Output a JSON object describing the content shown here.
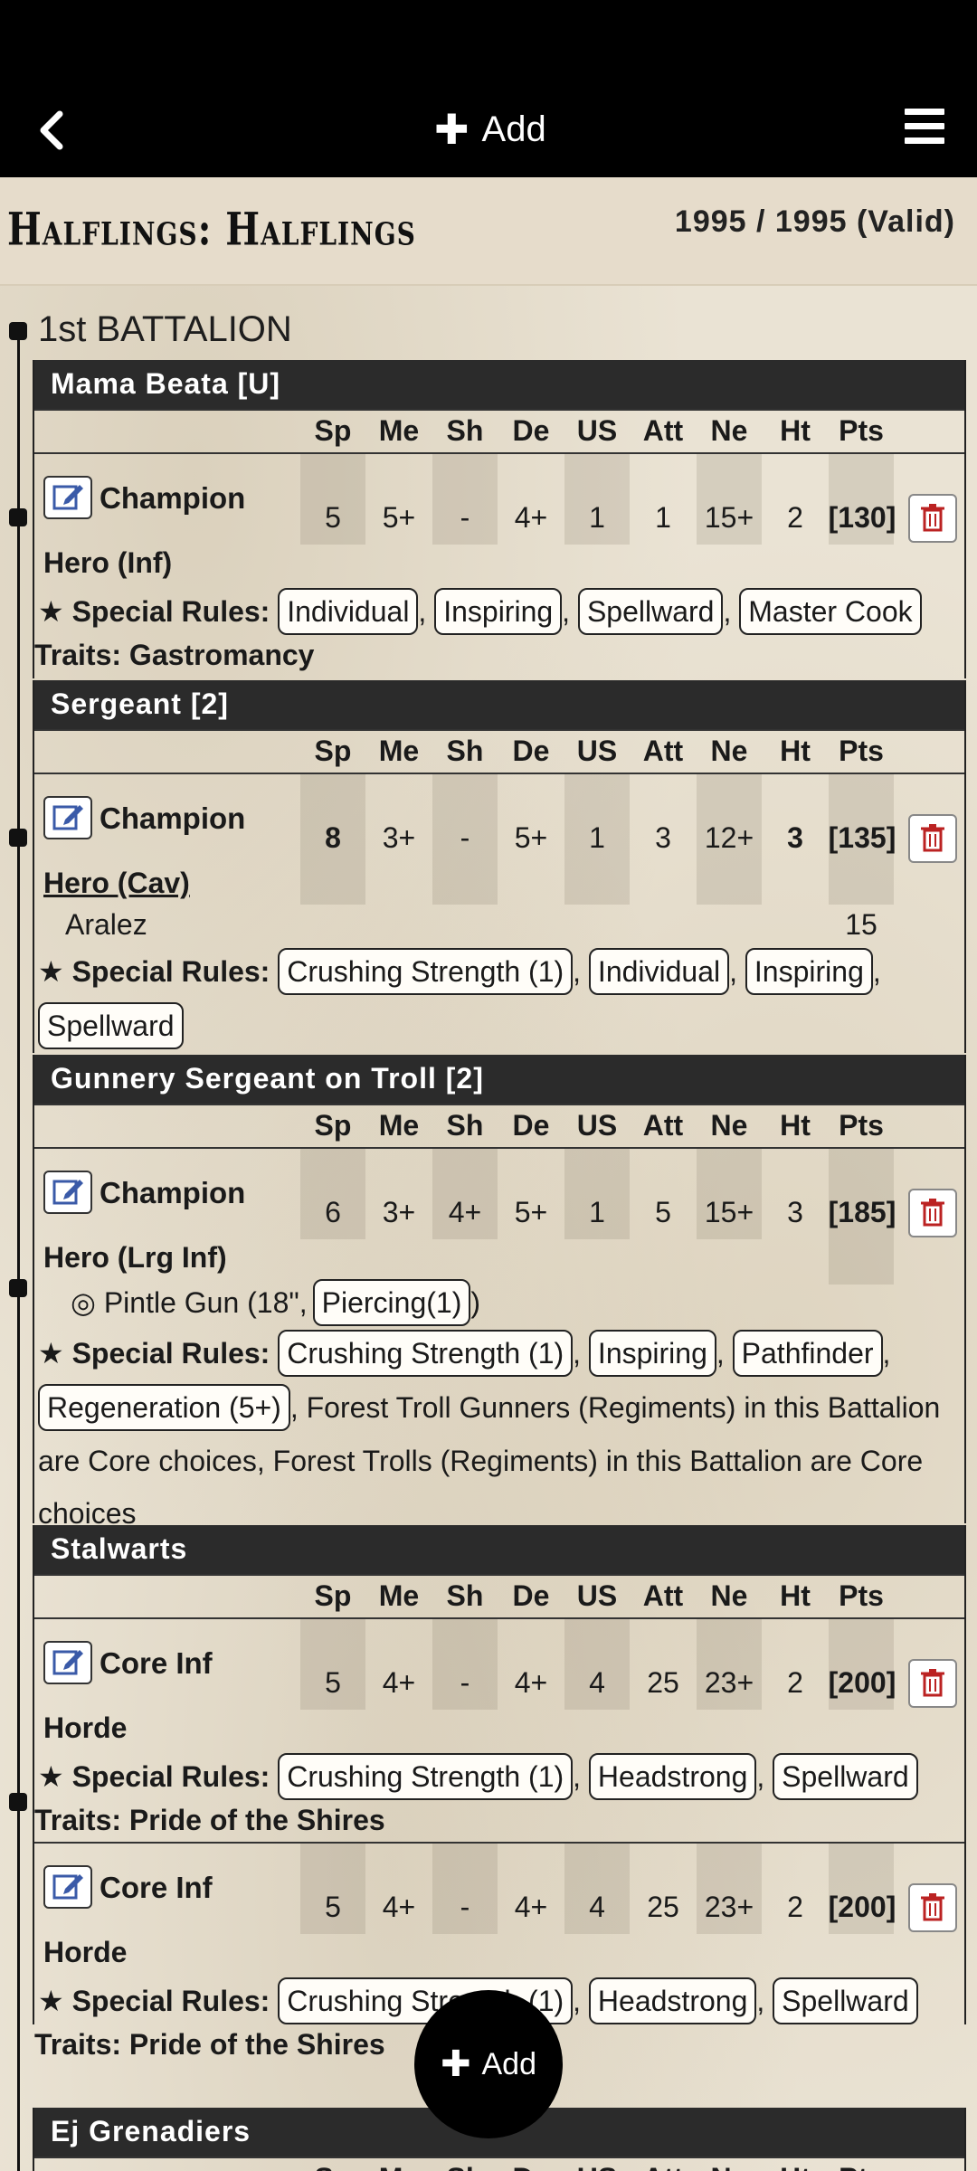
{
  "nav": {
    "add_label": "Add"
  },
  "list": {
    "title": "Halflings: Halflings",
    "points": "1995 / 1995 (Valid)"
  },
  "battalion": {
    "title": "1st BATTALION"
  },
  "stat_headers": [
    "Sp",
    "Me",
    "Sh",
    "De",
    "US",
    "Att",
    "Ne",
    "Ht",
    "Pts"
  ],
  "units": [
    {
      "name": "Mama Beata [U]",
      "rows": [
        {
          "type": "Champion",
          "stats": [
            "5",
            "5+",
            "-",
            "4+",
            "1",
            "1",
            "15+",
            "2",
            "[130]"
          ],
          "sub": "Hero (Inf)"
        }
      ],
      "rules_label": "Special Rules:",
      "rules": [
        "Individual",
        "Inspiring",
        "Spellward",
        "Master Cook"
      ],
      "traits": "Traits: Gastromancy"
    },
    {
      "name": "Sergeant [2]",
      "rows": [
        {
          "type": "Champion",
          "stats": [
            "8",
            "3+",
            "-",
            "5+",
            "1",
            "3",
            "12+",
            "3",
            "[135]"
          ],
          "sub": "Hero (Cav)"
        }
      ],
      "option": {
        "name": "Aralez",
        "pts": "15"
      },
      "rules_label": "Special Rules:",
      "rules": [
        "Crushing Strength (1)",
        "Individual",
        "Inspiring",
        "Spellward"
      ]
    },
    {
      "name": "Gunnery Sergeant on Troll [2]",
      "rows": [
        {
          "type": "Champion",
          "stats": [
            "6",
            "3+",
            "4+",
            "5+",
            "1",
            "5",
            "15+",
            "3",
            "[185]"
          ],
          "sub": "Hero (Lrg Inf)"
        }
      ],
      "weapon": {
        "name": "Pintle Gun (18\",",
        "tag": "Piercing(1)",
        "close": ")"
      },
      "rules_label": "Special Rules:",
      "rules": [
        "Crushing Strength (1)",
        "Inspiring",
        "Pathfinder",
        "Regeneration (5+)"
      ],
      "rules_extra": "Forest Troll Gunners (Regiments) in this Battalion are Core choices, Forest Trolls (Regiments) in this Battalion are Core choices"
    },
    {
      "name": "Stalwarts",
      "rows": [
        {
          "type": "Core Inf",
          "stats": [
            "5",
            "4+",
            "-",
            "4+",
            "4",
            "25",
            "23+",
            "2",
            "[200]"
          ],
          "sub": "Horde",
          "rules_label": "Special Rules:",
          "rules": [
            "Crushing Strength (1)",
            "Headstrong",
            "Spellward"
          ],
          "traits": "Traits: Pride of the Shires"
        },
        {
          "type": "Core Inf",
          "stats": [
            "5",
            "4+",
            "-",
            "4+",
            "4",
            "25",
            "23+",
            "2",
            "[200]"
          ],
          "sub": "Horde",
          "rules_label": "Special Rules:",
          "rules": [
            "Crushing Strength (1)",
            "Headstrong",
            "Spellward"
          ],
          "traits": "Traits: Pride of the Shires"
        }
      ]
    },
    {
      "name": "Ej Grenadiers"
    }
  ],
  "fab": {
    "label": "Add"
  }
}
